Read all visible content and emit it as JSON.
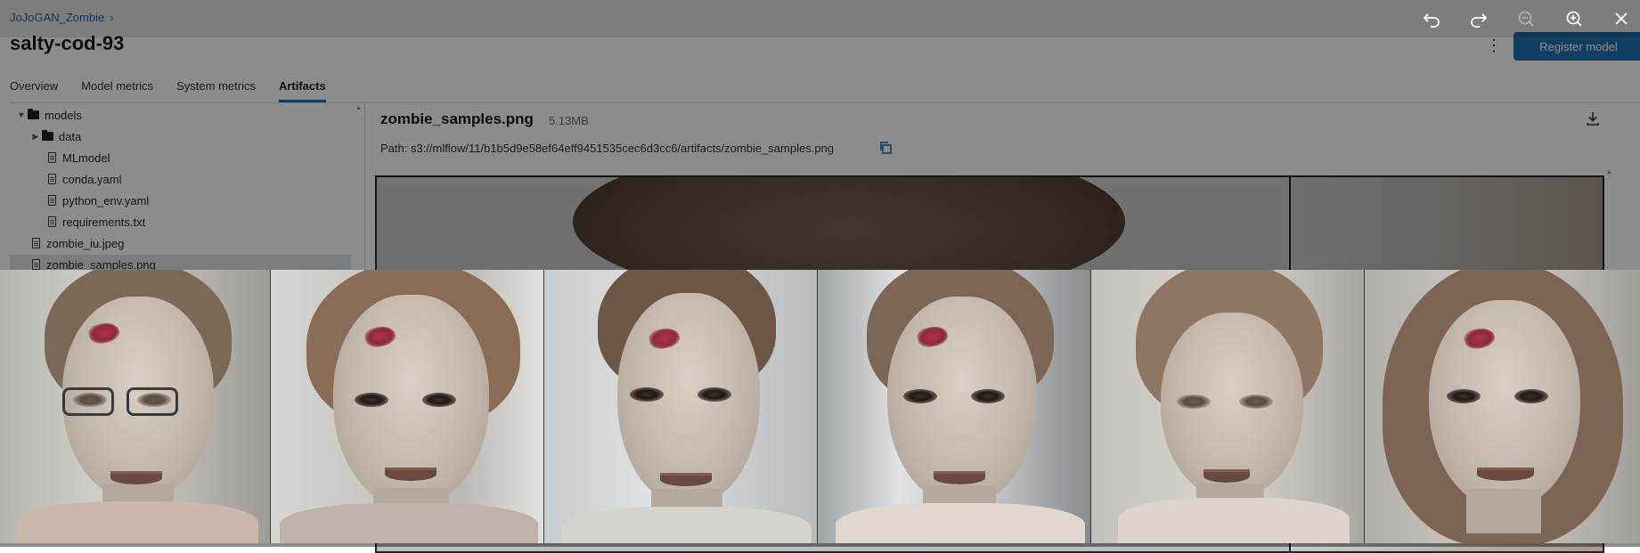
{
  "breadcrumb": {
    "experiment": "JoJoGAN_Zombie",
    "separator": "›"
  },
  "run": {
    "title": "salty-cod-93",
    "register_label": "Register model",
    "more_icon": "kebab-menu-icon"
  },
  "tabs": [
    {
      "label": "Overview",
      "active": false
    },
    {
      "label": "Model metrics",
      "active": false
    },
    {
      "label": "System metrics",
      "active": false
    },
    {
      "label": "Artifacts",
      "active": true
    }
  ],
  "tree": [
    {
      "label": "models",
      "kind": "folder",
      "expanded": true,
      "depth": 0
    },
    {
      "label": "data",
      "kind": "folder",
      "expanded": false,
      "depth": 1
    },
    {
      "label": "MLmodel",
      "kind": "file",
      "depth": 1
    },
    {
      "label": "conda.yaml",
      "kind": "file",
      "depth": 1
    },
    {
      "label": "python_env.yaml",
      "kind": "file",
      "depth": 1
    },
    {
      "label": "requirements.txt",
      "kind": "file",
      "depth": 1
    },
    {
      "label": "zombie_iu.jpeg",
      "kind": "file",
      "depth": 0
    },
    {
      "label": "zombie_samples.png",
      "kind": "file",
      "depth": 0,
      "selected": true
    }
  ],
  "artifact": {
    "name": "zombie_samples.png",
    "size": "5.13MB",
    "path": "Path: s3://mlflow/11/b1b5d9e58ef64eff9451535cec6d3cc6/artifacts/zombie_samples.png"
  },
  "lightbox": {
    "tools": [
      "undo-icon",
      "redo-icon",
      "zoom-out-icon",
      "zoom-in-icon",
      "close-icon"
    ],
    "zoom_out_disabled": true
  },
  "colors": {
    "accent": "#2272b4",
    "overlay": "rgba(0,0,0,0.45)"
  }
}
